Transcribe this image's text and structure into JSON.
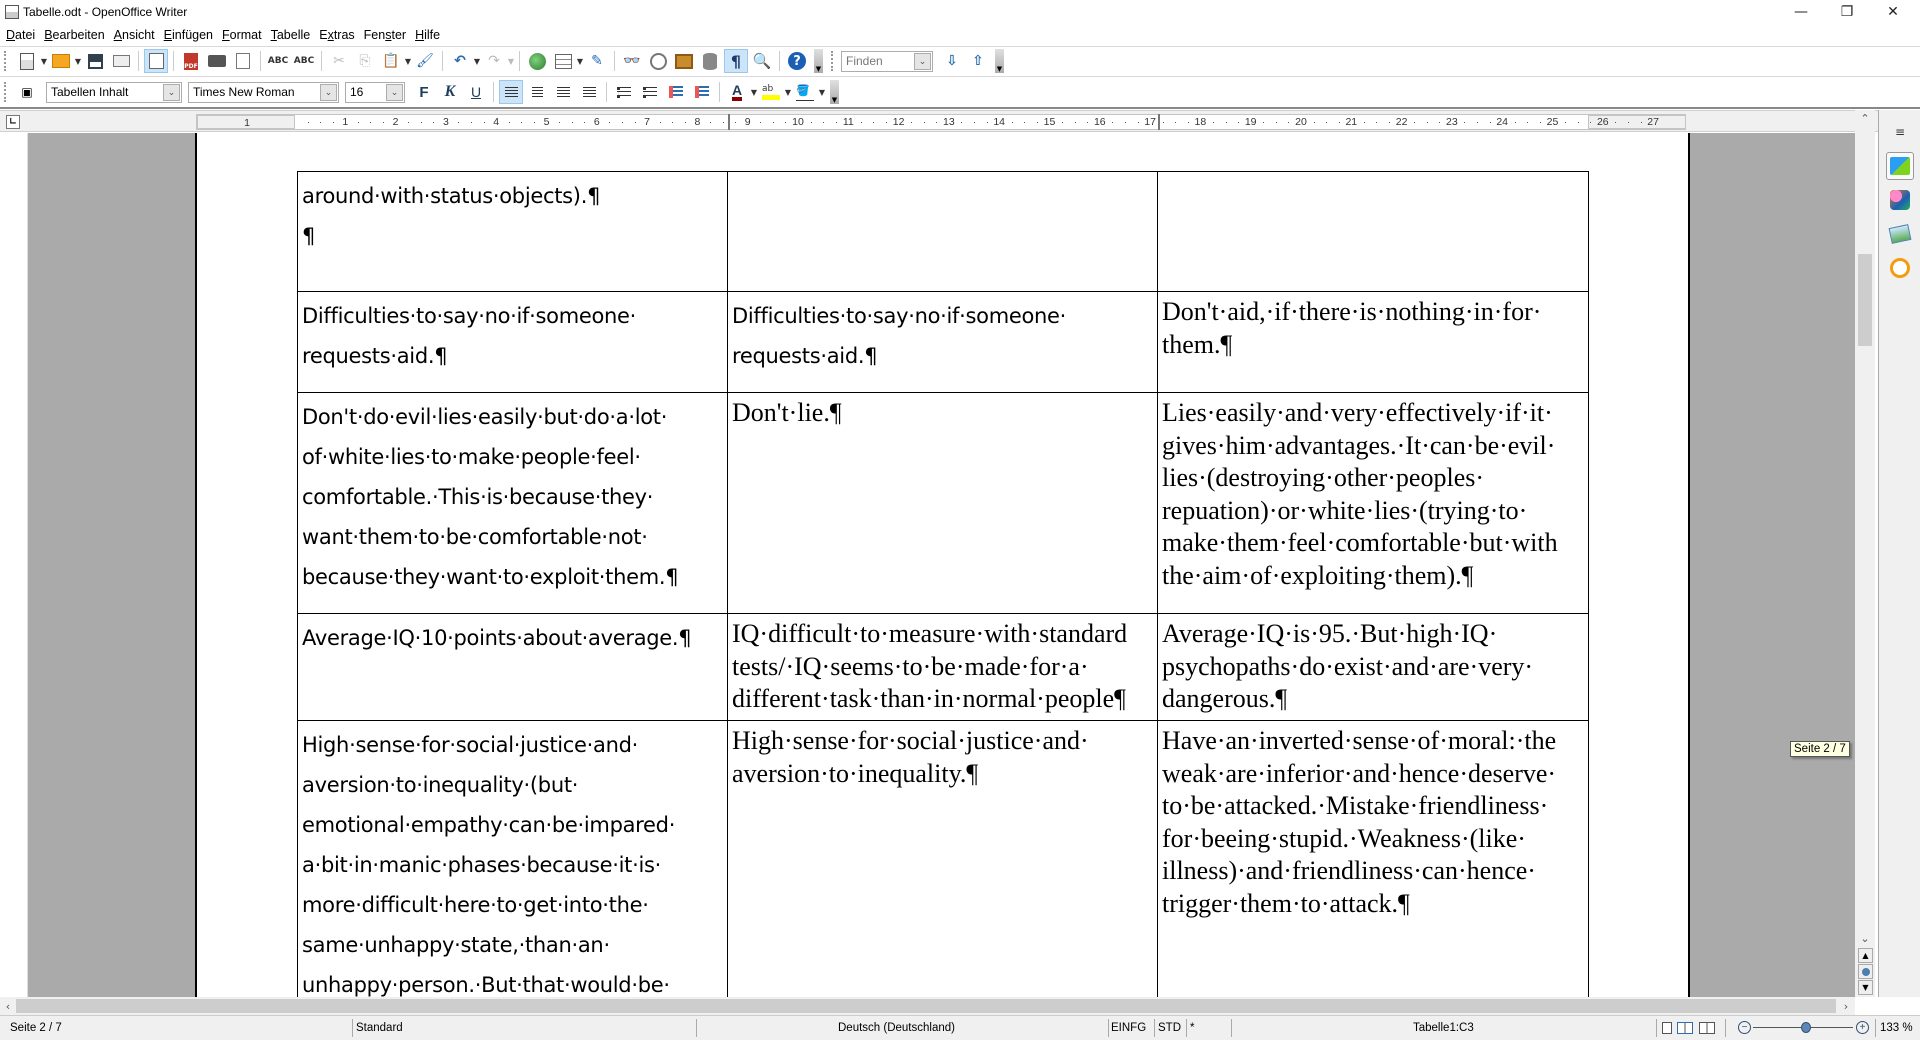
{
  "window": {
    "title": "Tabelle.odt - OpenOffice Writer",
    "minimize_label": "—",
    "maximize_label": "❐",
    "close_label": "✕"
  },
  "menu": {
    "items": [
      {
        "label": "Datei",
        "accel": "D"
      },
      {
        "label": "Bearbeiten",
        "accel": "B"
      },
      {
        "label": "Ansicht",
        "accel": "A"
      },
      {
        "label": "Einfügen",
        "accel": "E"
      },
      {
        "label": "Format",
        "accel": "F"
      },
      {
        "label": "Tabelle",
        "accel": "T"
      },
      {
        "label": "Extras",
        "accel": "x"
      },
      {
        "label": "Fenster",
        "accel": "s"
      },
      {
        "label": "Hilfe",
        "accel": "H"
      }
    ]
  },
  "toolbar_standard": {
    "find_placeholder": "Finden",
    "pdf_label": "PDF",
    "spell_label": "ABC",
    "autospell_label": "ABC",
    "help_label": "?",
    "pilcrow": "¶",
    "find_next": "⇩",
    "find_prev": "⇧"
  },
  "toolbar_format": {
    "paragraph_style": "Tabellen Inhalt",
    "font_name": "Times New Roman",
    "font_size": "16",
    "bold_label": "F",
    "italic_label": "K",
    "underline_label": "U",
    "font_color_label": "A",
    "highlight_label": "ab",
    "colors": {
      "font_color": "#8b0000",
      "highlight_color": "#ffff00"
    }
  },
  "ruler": {
    "left_margin_number": "1",
    "numbers": [
      "1",
      "2",
      "3",
      "4",
      "5",
      "6",
      "7",
      "8",
      "9",
      "10",
      "11",
      "12",
      "13",
      "14",
      "15",
      "16",
      "17",
      "18",
      "19",
      "20",
      "21",
      "22",
      "23",
      "24",
      "25",
      "26",
      "27"
    ],
    "unit": "cm"
  },
  "document": {
    "rows": [
      {
        "cells": [
          {
            "font": "sans",
            "paragraphs": [
              "around·with·status·objects).¶",
              "¶"
            ]
          },
          {
            "font": "sans",
            "paragraphs": []
          },
          {
            "font": "serif",
            "paragraphs": []
          }
        ]
      },
      {
        "cells": [
          {
            "font": "sans",
            "paragraphs": [
              "Difficulties·to·say·no·if·someone· requests·aid.¶"
            ]
          },
          {
            "font": "sans",
            "paragraphs": [
              "Difficulties·to·say·no·if·someone· requests·aid.¶"
            ]
          },
          {
            "font": "serif",
            "paragraphs": [
              "Don't·aid,·if·there·is·nothing·in·for· them.¶"
            ]
          }
        ]
      },
      {
        "cells": [
          {
            "font": "sans",
            "paragraphs": [
              "Don't·do·evil·lies·easily·but·do·a·lot· of·white·lies·to·make·people·feel· comfortable.·This·is·because·they· want·them·to·be·comfortable·not· because·they·want·to·exploit·them.¶"
            ]
          },
          {
            "font": "serif",
            "paragraphs": [
              "Don't·lie.¶"
            ]
          },
          {
            "font": "serif",
            "paragraphs": [
              "Lies·easily·and·very·effectively·if·it· gives·him·advantages.·It·can·be·evil· lies·(destroying·other·peoples· repuation)·or·white·lies·(trying·to· make·them·feel·comfortable·but·with the·aim·of·exploiting·them).¶"
            ]
          }
        ]
      },
      {
        "cells": [
          {
            "font": "sans",
            "paragraphs": [
              "Average·IQ·10·points·about·average.¶"
            ]
          },
          {
            "font": "serif",
            "paragraphs": [
              "IQ·difficult·to·measure·with·standard tests/·IQ·seems·to·be·made·for·a· different·task·than·in·normal·people¶"
            ]
          },
          {
            "font": "serif",
            "paragraphs": [
              "Average·IQ·is·95.·But·high·IQ· psychopaths·do·exist·and·are·very· dangerous.¶"
            ]
          }
        ]
      },
      {
        "cells": [
          {
            "font": "sans",
            "paragraphs": [
              "High·sense·for·social·justice·and· aversion·to·inequality·(but· emotional·empathy·can·be·impared· a·bit·in·manic·phases·because·it·is· more·difficult·here·to·get·into·the· same·unhappy·state,·than·an· unhappy·person.·But·that·would·be·"
            ]
          },
          {
            "font": "serif",
            "paragraphs": [
              "High·sense·for·social·justice·and· aversion·to·inequality.¶"
            ]
          },
          {
            "font": "serif",
            "paragraphs": [
              "Have·an·inverted·sense·of·moral:·the weak·are·inferior·and·hence·deserve· to·be·attacked.·Mistake·friendliness· for·beeing·stupid.·Weakness·(like· illness)·and·friendliness·can·hence· trigger·them·to·attack.¶"
            ]
          }
        ]
      }
    ]
  },
  "tooltip": {
    "text": "Seite 2 / 7"
  },
  "statusbar": {
    "page": "Seite 2 / 7",
    "page_style": "Standard",
    "language": "Deutsch (Deutschland)",
    "insert_mode": "EINFG",
    "selection_mode": "STD",
    "modified": "*",
    "cell": "Tabelle1:C3",
    "zoom": "133 %",
    "zoom_percent": 133
  }
}
